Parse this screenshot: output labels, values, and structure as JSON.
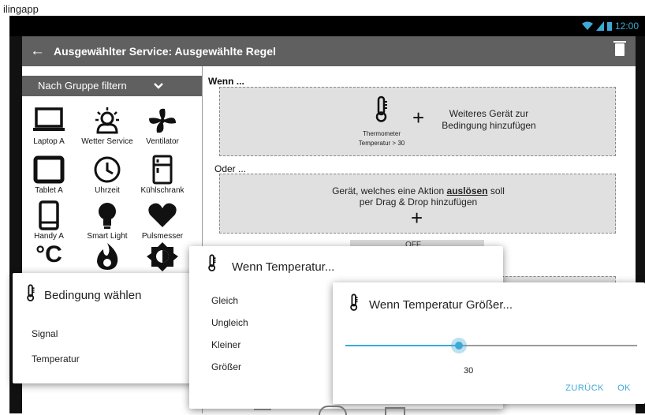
{
  "caption": "ilingapp",
  "status": {
    "time": "12:00"
  },
  "appbar": {
    "title": "Ausgewählter Service: Ausgewählte Regel",
    "back_icon": "arrow-left-icon",
    "delete_icon": "trash-icon"
  },
  "filter": {
    "label": "Nach Gruppe filtern",
    "icon": "chevron-down-icon"
  },
  "devices": [
    {
      "label": "Laptop A",
      "icon": "laptop-icon"
    },
    {
      "label": "Wetter Service",
      "icon": "weather-icon"
    },
    {
      "label": "Ventilator",
      "icon": "fan-icon"
    },
    {
      "label": "Tablet A",
      "icon": "tablet-icon"
    },
    {
      "label": "Uhrzeit",
      "icon": "clock-icon"
    },
    {
      "label": "Kühlschrank",
      "icon": "fridge-icon"
    },
    {
      "label": "Handy A",
      "icon": "phone-icon"
    },
    {
      "label": "Smart Light",
      "icon": "bulb-icon"
    },
    {
      "label": "Pulsmesser",
      "icon": "heart-icon"
    },
    {
      "label": "",
      "icon": "celsius-icon"
    },
    {
      "label": "",
      "icon": "flame-icon"
    },
    {
      "label": "",
      "icon": "brightness-icon"
    }
  ],
  "rule": {
    "wenn_label": "Wenn ...",
    "condition_device": "Thermometer",
    "condition_value": "Temperatur > 30",
    "add_condition": "Weiteres Gerät zur Bedingung hinzufügen",
    "oder_label": "Oder ...",
    "action_text_prefix": "Gerät, welches eine Aktion",
    "action_text_emph": "auslösen",
    "action_text_suffix": "soll",
    "action_text_line2": "per Drag & Drop hinzufügen",
    "hidden_button": "OFF"
  },
  "dialog1": {
    "title": "Bedingung wählen",
    "items": [
      "Signal",
      "Temperatur"
    ]
  },
  "dialog2": {
    "title": "Wenn Temperatur...",
    "items": [
      "Gleich",
      "Ungleich",
      "Kleiner",
      "Größer"
    ]
  },
  "dialog3": {
    "title": "Wenn Temperatur Größer...",
    "slider_value": "30",
    "slider_fraction": 0.39,
    "back": "ZURÜCK",
    "ok": "OK"
  },
  "colors": {
    "accent": "#3fa9d6",
    "appbar": "#606060",
    "dropzone": "#e0e0e0"
  }
}
